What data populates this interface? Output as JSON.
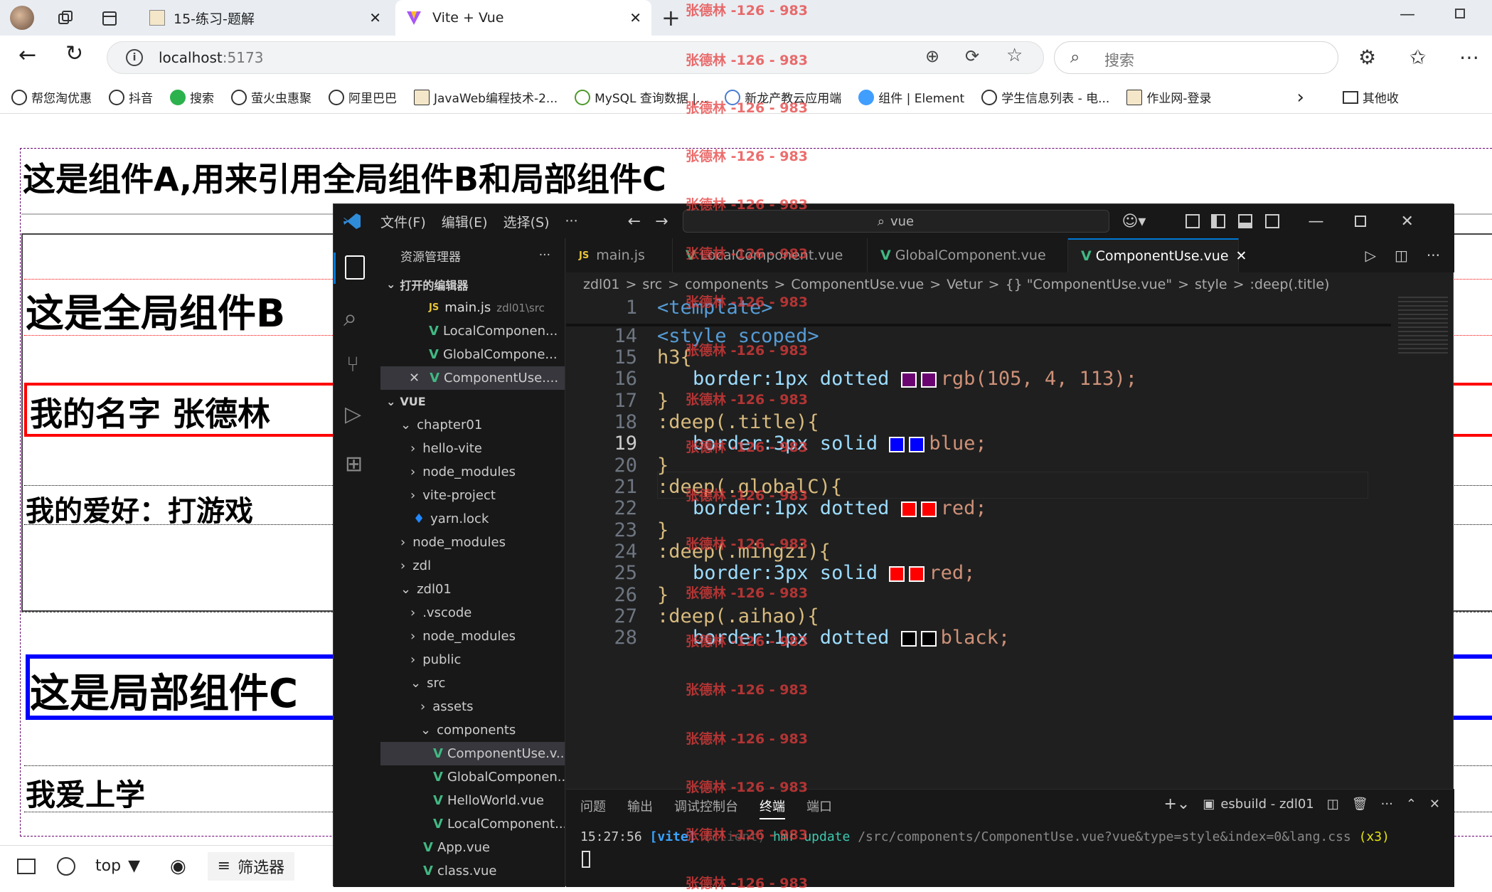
{
  "browser": {
    "tabs": [
      {
        "title": "15-练习-题解"
      },
      {
        "title": "Vite + Vue"
      }
    ],
    "url_host": "localhost",
    "url_port": ":5173",
    "search_placeholder": "搜索",
    "bookmarks": [
      "帮您淘优惠",
      "抖音",
      "搜索",
      "萤火虫惠聚",
      "阿里巴巴",
      "JavaWeb编程技术-2...",
      "MySQL 查询数据 |...",
      "新龙产教云应用端",
      "组件 | Element",
      "学生信息列表 - 电...",
      "作业网-登录"
    ],
    "other_bookmarks": "其他收"
  },
  "page": {
    "h_a": "这是组件A,用来引用全局组件B和局部组件C",
    "h_b": "这是全局组件B",
    "name": "我的名字 张德林",
    "hobby": "我的爱好：打游戏",
    "h_c": "这是局部组件C",
    "study": "我爱上学"
  },
  "devtools": {
    "context": "top",
    "filter": "筛选器"
  },
  "vscode": {
    "menu": [
      "文件(F)",
      "编辑(E)",
      "选择(S)",
      "···"
    ],
    "search": "vue",
    "explorer_title": "资源管理器",
    "open_editors": "打开的编辑器",
    "open_files": [
      {
        "name": "main.js",
        "path": "zdl01\\src",
        "icon": "JS"
      },
      {
        "name": "LocalComponen...",
        "icon": "V"
      },
      {
        "name": "GlobalCompone...",
        "icon": "V"
      },
      {
        "name": "ComponentUse....",
        "icon": "V"
      }
    ],
    "root": "VUE",
    "tree": [
      {
        "name": "chapter01",
        "indent": 1,
        "kind": "open"
      },
      {
        "name": "hello-vite",
        "indent": 2,
        "kind": "closed"
      },
      {
        "name": "node_modules",
        "indent": 2,
        "kind": "closed"
      },
      {
        "name": "vite-project",
        "indent": 2,
        "kind": "closed"
      },
      {
        "name": "yarn.lock",
        "indent": 2,
        "kind": "file"
      },
      {
        "name": "node_modules",
        "indent": 1,
        "kind": "closed"
      },
      {
        "name": "zdl",
        "indent": 1,
        "kind": "closed"
      },
      {
        "name": "zdl01",
        "indent": 1,
        "kind": "open"
      },
      {
        "name": ".vscode",
        "indent": 2,
        "kind": "closed"
      },
      {
        "name": "node_modules",
        "indent": 2,
        "kind": "closed"
      },
      {
        "name": "public",
        "indent": 2,
        "kind": "closed"
      },
      {
        "name": "src",
        "indent": 2,
        "kind": "open"
      },
      {
        "name": "assets",
        "indent": 3,
        "kind": "closed"
      },
      {
        "name": "components",
        "indent": 3,
        "kind": "open"
      },
      {
        "name": "ComponentUse.v...",
        "indent": 4,
        "kind": "vue"
      },
      {
        "name": "GlobalComponen...",
        "indent": 4,
        "kind": "vue"
      },
      {
        "name": "HelloWorld.vue",
        "indent": 4,
        "kind": "vue"
      },
      {
        "name": "LocalComponent....",
        "indent": 4,
        "kind": "vue"
      },
      {
        "name": "App.vue",
        "indent": 3,
        "kind": "vue"
      },
      {
        "name": "class.vue",
        "indent": 3,
        "kind": "vue"
      }
    ],
    "tabs": [
      {
        "name": "main.js",
        "icon": "JS"
      },
      {
        "name": "LocalComponent.vue",
        "icon": "V"
      },
      {
        "name": "GlobalComponent.vue",
        "icon": "V"
      },
      {
        "name": "ComponentUse.vue",
        "icon": "V"
      }
    ],
    "breadcrumb": [
      "zdl01",
      ">",
      "src",
      ">",
      "components",
      ">",
      "ComponentUse.vue",
      ">",
      "Vetur",
      ">",
      "{} \"ComponentUse.vue\"",
      ">",
      "style",
      ">",
      ":deep(.title)"
    ],
    "code": [
      {
        "n": "1",
        "t": "<template>"
      },
      {
        "n": "14",
        "t": "<style scoped>"
      },
      {
        "n": "15",
        "t": "h3{"
      },
      {
        "n": "16",
        "t": "border:1px dotted rgb(105, 4, 113);",
        "swatch": "#690471"
      },
      {
        "n": "17",
        "t": "}"
      },
      {
        "n": "18",
        "t": ":deep(.title){"
      },
      {
        "n": "19",
        "t": "border:3px solid blue;",
        "swatch": "#0000ff"
      },
      {
        "n": "20",
        "t": "}"
      },
      {
        "n": "21",
        "t": ":deep(.globalC){"
      },
      {
        "n": "22",
        "t": "border:1px dotted red;",
        "swatch": "#ff0000"
      },
      {
        "n": "23",
        "t": "}"
      },
      {
        "n": "24",
        "t": ":deep(.mingzi){"
      },
      {
        "n": "25",
        "t": "border:3px solid red;",
        "swatch": "#ff0000"
      },
      {
        "n": "26",
        "t": "}"
      },
      {
        "n": "27",
        "t": ":deep(.aihao){"
      },
      {
        "n": "28",
        "t": "border:1px dotted black;",
        "swatch": "#000000"
      }
    ],
    "panel_tabs": [
      "问题",
      "输出",
      "调试控制台",
      "终端",
      "端口"
    ],
    "terminal_name": "esbuild - zdl01",
    "terminal_line": {
      "time": "15:27:56",
      "tag": "[vite]",
      "client": "(client)",
      "msg": "hmr update",
      "path": "/src/components/ComponentUse.vue?vue&type=style&index=0&lang.css",
      "count": "(x3)"
    }
  },
  "watermark": "张德林 -126 - 983"
}
